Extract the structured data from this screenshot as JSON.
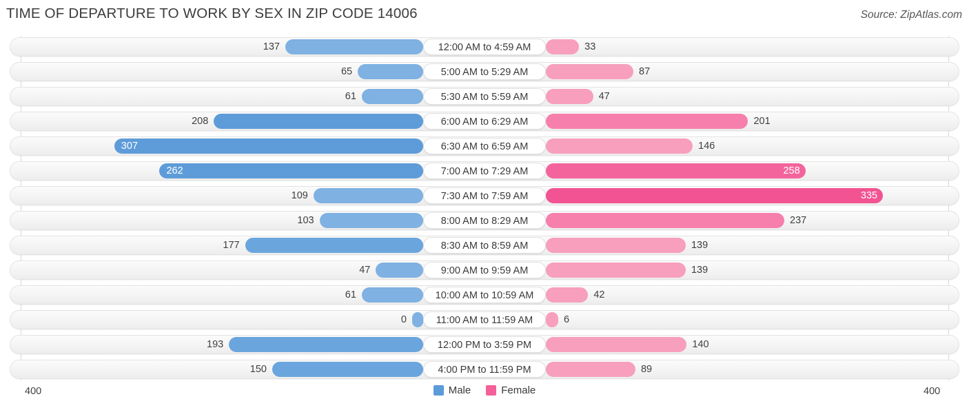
{
  "header": {
    "title": "TIME OF DEPARTURE TO WORK BY SEX IN ZIP CODE 14006",
    "source": "Source: ZipAtlas.com"
  },
  "axis": {
    "left_max_label": "400",
    "right_max_label": "400"
  },
  "legend": {
    "items": [
      {
        "label": "Male",
        "color": "#5b9bd9"
      },
      {
        "label": "Female",
        "color": "#f4609a"
      }
    ]
  },
  "colors": {
    "male_bar": "#7fb1e2",
    "female_bar": "#f79fbd",
    "male_legend": "#5b9bd9",
    "female_legend": "#f4609a",
    "track": "#f4f4f4",
    "gridline": "#d9d9d9",
    "text": "#3f3f3f"
  },
  "chart_data": {
    "type": "bar",
    "title": "TIME OF DEPARTURE TO WORK BY SEX IN ZIP CODE 14006",
    "subtitle": "",
    "orientation": "horizontal-diverging",
    "xlabel": "",
    "ylabel": "",
    "xlim": [
      400,
      400
    ],
    "grid": true,
    "legend_position": "bottom-center",
    "categories": [
      "12:00 AM to 4:59 AM",
      "5:00 AM to 5:29 AM",
      "5:30 AM to 5:59 AM",
      "6:00 AM to 6:29 AM",
      "6:30 AM to 6:59 AM",
      "7:00 AM to 7:29 AM",
      "7:30 AM to 7:59 AM",
      "8:00 AM to 8:29 AM",
      "8:30 AM to 8:59 AM",
      "9:00 AM to 9:59 AM",
      "10:00 AM to 10:59 AM",
      "11:00 AM to 11:59 AM",
      "12:00 PM to 3:59 PM",
      "4:00 PM to 11:59 PM"
    ],
    "series": [
      {
        "name": "Male",
        "color": "#7fb1e2",
        "values": [
          137,
          65,
          61,
          208,
          307,
          262,
          109,
          103,
          177,
          47,
          61,
          0,
          193,
          150
        ]
      },
      {
        "name": "Female",
        "color": "#f79fbd",
        "values": [
          33,
          87,
          47,
          201,
          146,
          258,
          335,
          237,
          139,
          139,
          42,
          6,
          140,
          89
        ]
      }
    ]
  }
}
